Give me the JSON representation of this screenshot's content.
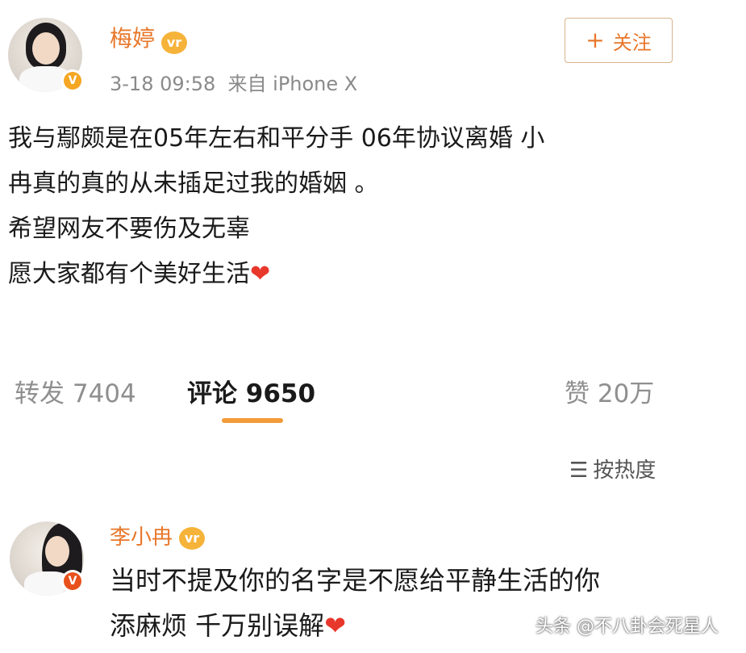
{
  "post": {
    "author": "梅婷",
    "meta": "3-18 09:58  来自 iPhone X",
    "follow_label": "关注",
    "lines": [
      "我与鄢颇是在05年左右和平分手  06年协议离婚 小",
      "冉真的真的从未插足过我的婚姻 。",
      "希望网友不要伤及无辜",
      "愿大家都有个美好生活"
    ],
    "heart": "❤"
  },
  "stats": {
    "repost": "转发 7404",
    "comment": "评论 9650",
    "like": "赞 20万"
  },
  "sort": {
    "label": "按热度"
  },
  "comment": {
    "author": "李小冉",
    "lines": [
      "当时不提及你的名字是不愿给平静生活的你",
      "添麻烦 千万别误解"
    ],
    "heart": "❤"
  },
  "watermark": "头条 @不八卦会死星人",
  "colors": {
    "username": "#e8772a",
    "accent_underline": "#f39b3a",
    "heart": "#e8382c"
  }
}
